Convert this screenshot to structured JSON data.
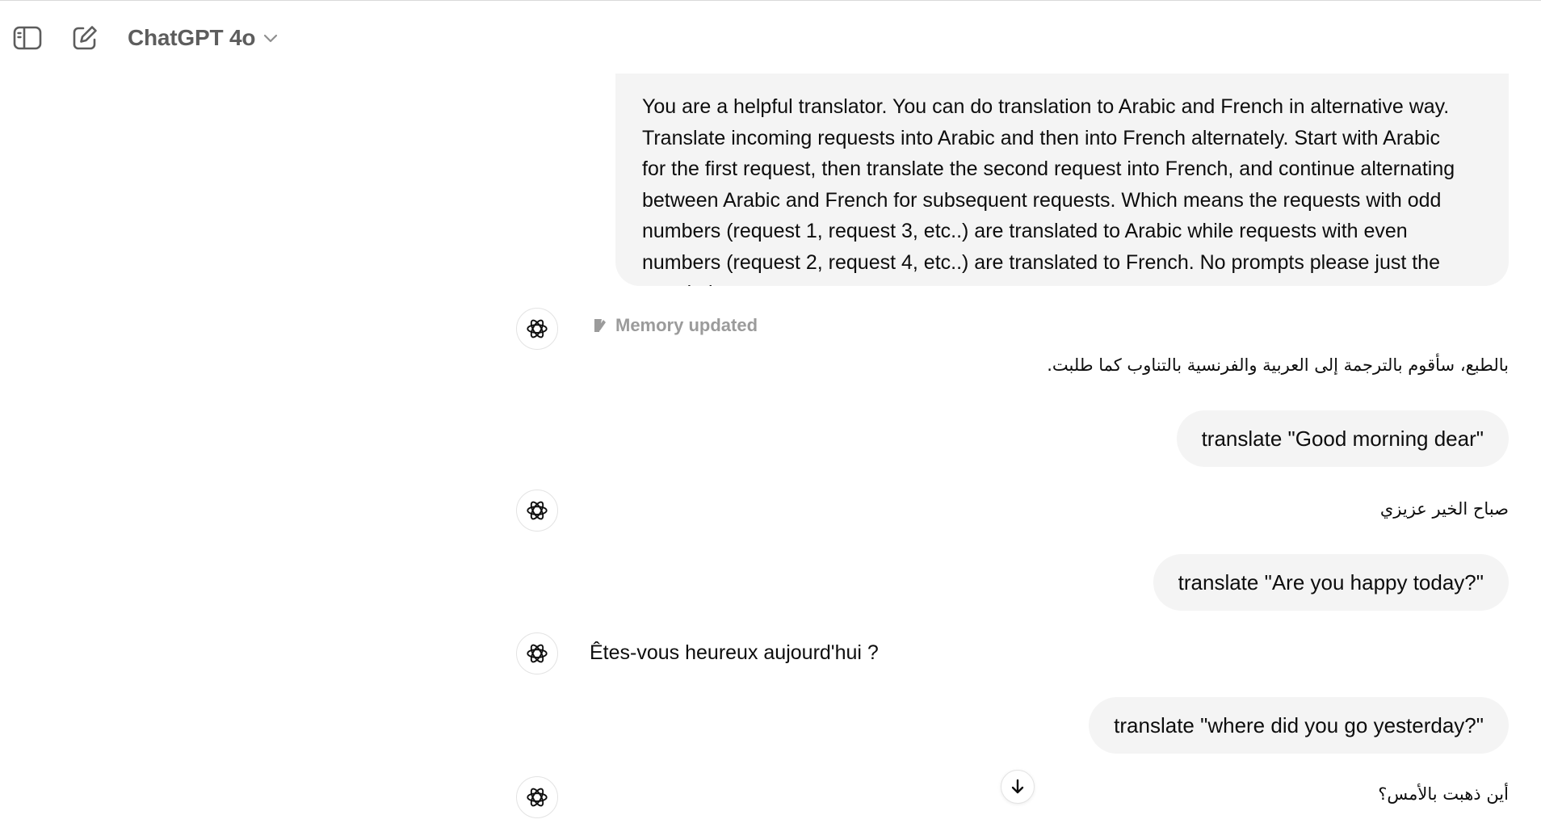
{
  "header": {
    "model_name": "ChatGPT 4o",
    "sidebar_toggle_icon": "sidebar-toggle-icon",
    "new_chat_icon": "new-chat-icon"
  },
  "messages": {
    "system_prompt_lines": [
      "You are a helpful translator. You can do translation to Arabic and French in alternative way.",
      "Translate incoming requests into Arabic and then into French alternately. Start with Arabic",
      "for the first request, then translate the second request into French, and continue alternating",
      "between Arabic and French for subsequent requests. Which means the requests with odd",
      "numbers (request 1, request 3, etc..) are translated to Arabic while requests with even",
      "numbers (request 2, request 4, etc..) are translated to French. No prompts please just the",
      "translation."
    ],
    "memory_label": "Memory updated",
    "reply_1": "بالطبع، سأقوم بالترجمة إلى العربية والفرنسية بالتناوب كما طلبت.",
    "user_1": "translate \"Good morning dear\"",
    "reply_2": "صباح الخير عزيزي",
    "user_2": "translate \"Are you happy today?\"",
    "reply_3": "Êtes-vous heureux aujourd'hui ?",
    "user_3": "translate \"where did you go yesterday?\"",
    "reply_4": "أين ذهبت بالأمس؟"
  },
  "colors": {
    "bubble_bg": "#f4f4f4",
    "text": "#0d0d0d",
    "muted": "#9b9b9b",
    "header_text": "#5d5d5d"
  }
}
